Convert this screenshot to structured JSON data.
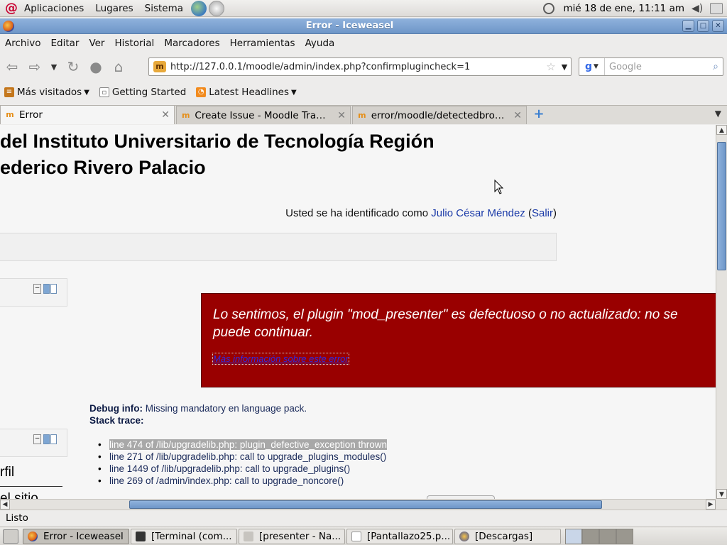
{
  "panel": {
    "apps": "Aplicaciones",
    "places": "Lugares",
    "system": "Sistema",
    "clock": "mié 18 de ene, 11:11 am"
  },
  "window": {
    "title": "Error - Iceweasel",
    "title_color": "#7aa0d0"
  },
  "menubar": {
    "items": [
      {
        "label": "Archivo"
      },
      {
        "label": "Editar"
      },
      {
        "label": "Ver"
      },
      {
        "label": "Historial"
      },
      {
        "label": "Marcadores"
      },
      {
        "label": "Herramientas"
      },
      {
        "label": "Ayuda"
      }
    ]
  },
  "navbar": {
    "url": "http://127.0.0.1/moodle/admin/index.php?confirmplugincheck=1",
    "search_placeholder": "Google"
  },
  "bookmarks": {
    "items": [
      {
        "label": "Más visitados",
        "icon": "most-visited-icon"
      },
      {
        "label": "Getting Started",
        "icon": "page-icon"
      },
      {
        "label": "Latest Headlines",
        "icon": "rss-icon"
      }
    ]
  },
  "tabs": [
    {
      "label": "Error",
      "active": true
    },
    {
      "label": "Create Issue - Moodle Tracker",
      "active": false
    },
    {
      "label": "error/moodle/detectedbrok...",
      "active": false
    }
  ],
  "page": {
    "site_title_line1": "del Instituto Universitario de Tecnología Región",
    "site_title_line2": "ederico Rivero Palacio",
    "login_prefix": "Usted se ha identificado como ",
    "login_user": "Julio César Méndez",
    "login_open": " (",
    "login_logout": "Salir",
    "login_close": ")",
    "error_message": "Lo sentimos, el plugin \"mod_presenter\" es defectuoso o no actualizado: no se puede continuar.",
    "error_link": "Más información sobre este error",
    "debug_label": "Debug info:",
    "debug_text": " Missing mandatory en language pack.",
    "stack_label": "Stack trace:",
    "stack_trace": [
      "line 474 of /lib/upgradelib.php: plugin_defective_exception thrown",
      "line 271 of /lib/upgradelib.php: call to upgrade_plugins_modules()",
      "line 1449 of /lib/upgradelib.php: call to upgrade_plugins()",
      "line 269 of /admin/index.php: call to upgrade_noncore()"
    ],
    "side_text1": "rfil",
    "side_text2": "el sitio",
    "error_color": "#990000"
  },
  "statusbar": {
    "text": "Listo"
  },
  "taskbar": {
    "tasks": [
      {
        "label": "Error - Iceweasel",
        "active": true
      },
      {
        "label": "[Terminal (com...",
        "active": false
      },
      {
        "label": "[presenter - Na...",
        "active": false
      },
      {
        "label": "[Pantallazo25.p...",
        "active": false
      },
      {
        "label": "[Descargas]",
        "active": false
      }
    ]
  }
}
